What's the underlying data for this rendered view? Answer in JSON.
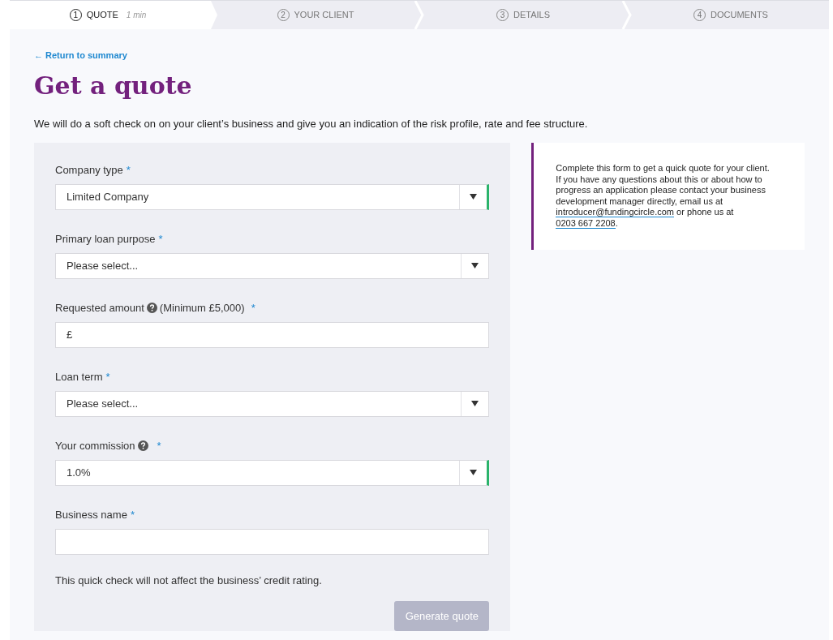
{
  "steps": [
    {
      "number": "1",
      "label": "QUOTE",
      "note": "1 min",
      "selected": true
    },
    {
      "number": "2",
      "label": "YOUR CLIENT",
      "selected": false
    },
    {
      "number": "3",
      "label": "DETAILS",
      "selected": false
    },
    {
      "number": "4",
      "label": "DOCUMENTS",
      "selected": false
    }
  ],
  "back_link": "← Return to summary",
  "title": "Get a quote",
  "intro": "We will do a soft check on on your client’s business and give you an indication of the risk profile, rate and fee structure.",
  "form": {
    "fields": [
      {
        "kind": "select",
        "label": "Company type",
        "required_mark": "*",
        "value": "Limited Company",
        "valid": true
      },
      {
        "kind": "select",
        "label": "Primary loan purpose",
        "required_mark": "*",
        "value": "Please select...",
        "valid": false
      },
      {
        "kind": "input",
        "label": "Requested amount",
        "help": true,
        "label_suffix": "(Minimum £5,000)",
        "required_mark": "*",
        "value": "£"
      },
      {
        "kind": "select",
        "label": "Loan term",
        "required_mark": "*",
        "value": "Please select...",
        "valid": false
      },
      {
        "kind": "select",
        "label": "Your commission",
        "help": true,
        "required_mark": "*",
        "value": "1.0%",
        "valid": true
      },
      {
        "kind": "input",
        "label": "Business name",
        "required_mark": "*"
      }
    ],
    "note": "This quick check will not affect the business’ credit rating.",
    "submit": {
      "label": "Generate quote",
      "disabled": true
    }
  },
  "info": {
    "before": "Complete this form to get a quick quote for your client. If you have any questions about this or about how to progress an application please contact your business development manager directly, email us at ",
    "email": "introducer@fundingcircle.com",
    "middle": " or phone us at ",
    "phone": "0203 667 2208",
    "after": "."
  }
}
